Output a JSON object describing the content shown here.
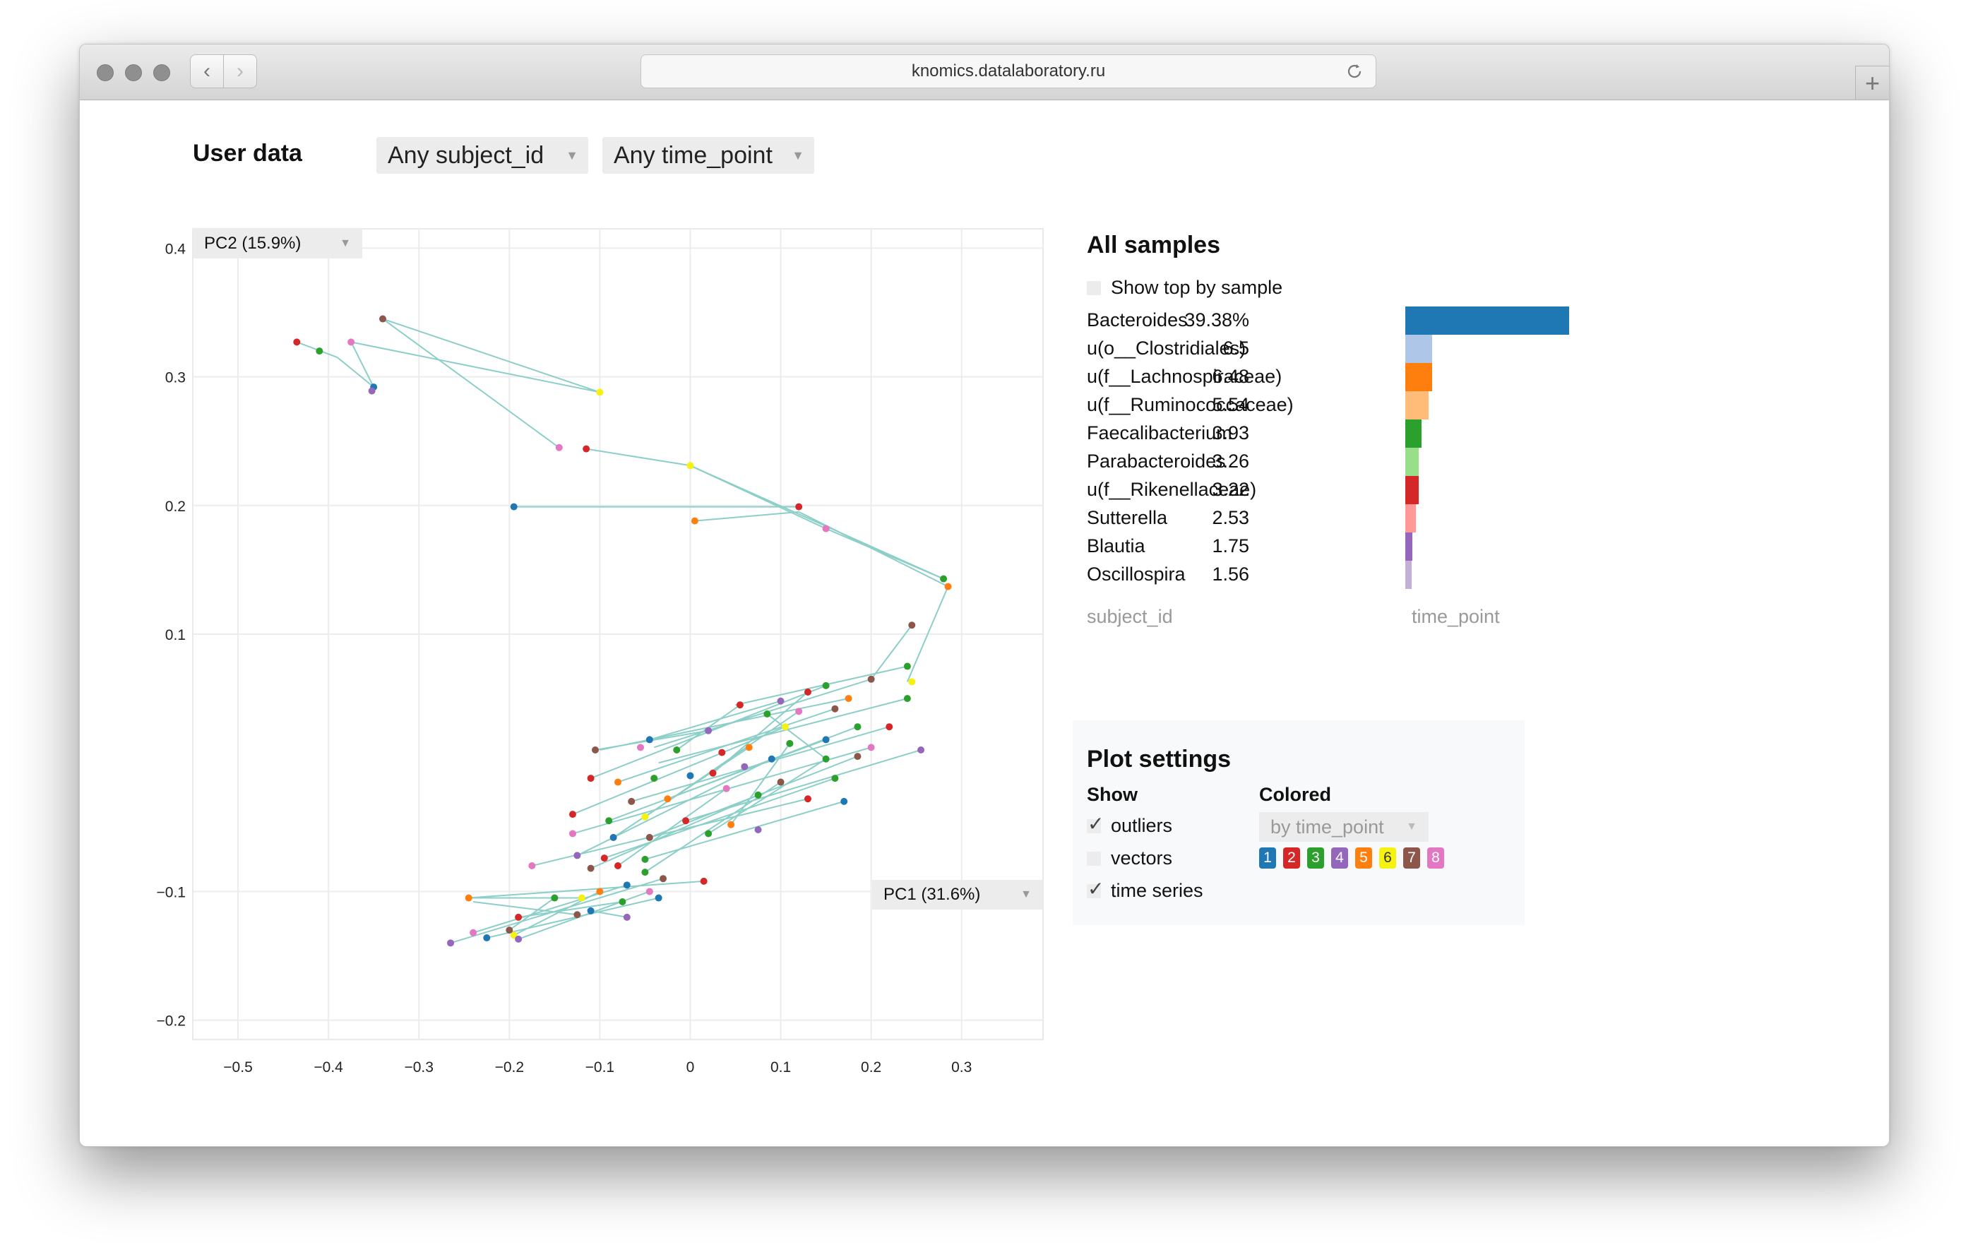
{
  "browser": {
    "url": "knomics.datalaboratory.ru"
  },
  "header": {
    "title": "User data",
    "subject_dropdown": "Any subject_id",
    "time_dropdown": "Any time_point"
  },
  "axes": {
    "y_select": "PC2 (15.9%)",
    "x_select": "PC1 (31.6%)"
  },
  "chart_data": {
    "type": "scatter",
    "xlim": [
      -0.55,
      0.39
    ],
    "ylim": [
      -0.215,
      0.415
    ],
    "x_ticks": [
      -0.5,
      -0.4,
      -0.3,
      -0.2,
      -0.1,
      0,
      0.1,
      0.2,
      0.3
    ],
    "x_tick_labels": [
      "−0.5",
      "−0.4",
      "−0.3",
      "−0.2",
      "−0.1",
      "0",
      "0.1",
      "0.2",
      "0.3"
    ],
    "y_ticks": [
      -0.2,
      -0.1,
      0.1,
      0.2,
      0.3,
      0.4
    ],
    "y_tick_labels": [
      "−0.2",
      "−0.1",
      "0.1",
      "0.2",
      "0.3",
      "0.4"
    ],
    "grid": true,
    "legend": "none",
    "point_colors": [
      "#1f77b4",
      "#d62728",
      "#2ca02c",
      "#9467bd",
      "#ff7f0e",
      "#f5f20f",
      "#8c564b",
      "#e377c2"
    ],
    "vector_color": "#8ccfc8",
    "points": [
      {
        "x": -0.435,
        "y": 0.327,
        "c": 2
      },
      {
        "x": -0.41,
        "y": 0.32,
        "c": 3
      },
      {
        "x": -0.375,
        "y": 0.327,
        "c": 8
      },
      {
        "x": -0.35,
        "y": 0.292,
        "c": 1
      },
      {
        "x": -0.352,
        "y": 0.289,
        "c": 4
      },
      {
        "x": -0.34,
        "y": 0.345,
        "c": 7
      },
      {
        "x": -0.1,
        "y": 0.288,
        "c": 6
      },
      {
        "x": -0.145,
        "y": 0.245,
        "c": 8
      },
      {
        "x": -0.115,
        "y": 0.244,
        "c": 2
      },
      {
        "x": -0.195,
        "y": 0.199,
        "c": 1
      },
      {
        "x": 0.0,
        "y": 0.231,
        "c": 6
      },
      {
        "x": 0.005,
        "y": 0.188,
        "c": 5
      },
      {
        "x": 0.12,
        "y": 0.199,
        "c": 2
      },
      {
        "x": 0.15,
        "y": 0.182,
        "c": 8
      },
      {
        "x": 0.28,
        "y": 0.143,
        "c": 3
      },
      {
        "x": 0.285,
        "y": 0.137,
        "c": 5
      },
      {
        "x": 0.245,
        "y": 0.107,
        "c": 7
      },
      {
        "x": 0.24,
        "y": 0.075,
        "c": 3
      },
      {
        "x": 0.245,
        "y": 0.063,
        "c": 6
      },
      {
        "x": 0.24,
        "y": 0.05,
        "c": 3
      },
      {
        "x": 0.2,
        "y": 0.065,
        "c": 7
      },
      {
        "x": 0.175,
        "y": 0.05,
        "c": 5
      },
      {
        "x": 0.15,
        "y": 0.06,
        "c": 3
      },
      {
        "x": 0.13,
        "y": 0.055,
        "c": 2
      },
      {
        "x": 0.1,
        "y": 0.048,
        "c": 4
      },
      {
        "x": 0.055,
        "y": 0.045,
        "c": 2
      },
      {
        "x": 0.085,
        "y": 0.038,
        "c": 3
      },
      {
        "x": 0.12,
        "y": 0.04,
        "c": 8
      },
      {
        "x": 0.16,
        "y": 0.042,
        "c": 7
      },
      {
        "x": 0.185,
        "y": 0.028,
        "c": 3
      },
      {
        "x": 0.105,
        "y": 0.028,
        "c": 6
      },
      {
        "x": 0.02,
        "y": 0.025,
        "c": 4
      },
      {
        "x": -0.045,
        "y": 0.018,
        "c": 1
      },
      {
        "x": 0.22,
        "y": 0.028,
        "c": 2
      },
      {
        "x": 0.15,
        "y": 0.018,
        "c": 1
      },
      {
        "x": 0.2,
        "y": 0.012,
        "c": 8
      },
      {
        "x": 0.255,
        "y": 0.01,
        "c": 4
      },
      {
        "x": 0.11,
        "y": 0.015,
        "c": 3
      },
      {
        "x": 0.065,
        "y": 0.012,
        "c": 5
      },
      {
        "x": 0.035,
        "y": 0.008,
        "c": 2
      },
      {
        "x": -0.015,
        "y": 0.01,
        "c": 3
      },
      {
        "x": -0.105,
        "y": 0.01,
        "c": 7
      },
      {
        "x": -0.055,
        "y": 0.012,
        "c": 8
      },
      {
        "x": 0.185,
        "y": 0.005,
        "c": 7
      },
      {
        "x": 0.15,
        "y": 0.003,
        "c": 3
      },
      {
        "x": 0.09,
        "y": 0.003,
        "c": 1
      },
      {
        "x": 0.06,
        "y": -0.003,
        "c": 4
      },
      {
        "x": 0.025,
        "y": -0.008,
        "c": 2
      },
      {
        "x": 0.0,
        "y": -0.01,
        "c": 1
      },
      {
        "x": -0.04,
        "y": -0.012,
        "c": 3
      },
      {
        "x": -0.08,
        "y": -0.015,
        "c": 5
      },
      {
        "x": -0.11,
        "y": -0.012,
        "c": 2
      },
      {
        "x": 0.1,
        "y": -0.015,
        "c": 7
      },
      {
        "x": 0.16,
        "y": -0.012,
        "c": 3
      },
      {
        "x": 0.04,
        "y": -0.02,
        "c": 8
      },
      {
        "x": 0.075,
        "y": -0.025,
        "c": 3
      },
      {
        "x": 0.13,
        "y": -0.028,
        "c": 2
      },
      {
        "x": 0.17,
        "y": -0.03,
        "c": 1
      },
      {
        "x": -0.025,
        "y": -0.028,
        "c": 5
      },
      {
        "x": -0.065,
        "y": -0.03,
        "c": 7
      },
      {
        "x": -0.13,
        "y": -0.04,
        "c": 2
      },
      {
        "x": -0.09,
        "y": -0.045,
        "c": 3
      },
      {
        "x": -0.05,
        "y": -0.042,
        "c": 6
      },
      {
        "x": -0.005,
        "y": -0.045,
        "c": 2
      },
      {
        "x": 0.045,
        "y": -0.048,
        "c": 5
      },
      {
        "x": 0.075,
        "y": -0.052,
        "c": 4
      },
      {
        "x": -0.13,
        "y": -0.055,
        "c": 8
      },
      {
        "x": -0.085,
        "y": -0.058,
        "c": 1
      },
      {
        "x": -0.045,
        "y": -0.058,
        "c": 7
      },
      {
        "x": 0.02,
        "y": -0.055,
        "c": 3
      },
      {
        "x": -0.125,
        "y": -0.072,
        "c": 4
      },
      {
        "x": -0.095,
        "y": -0.074,
        "c": 2
      },
      {
        "x": -0.05,
        "y": -0.075,
        "c": 3
      },
      {
        "x": -0.11,
        "y": -0.082,
        "c": 7
      },
      {
        "x": -0.08,
        "y": -0.08,
        "c": 2
      },
      {
        "x": -0.175,
        "y": -0.08,
        "c": 8
      },
      {
        "x": -0.05,
        "y": -0.085,
        "c": 3
      },
      {
        "x": -0.03,
        "y": -0.09,
        "c": 7
      },
      {
        "x": 0.015,
        "y": -0.092,
        "c": 2
      },
      {
        "x": -0.07,
        "y": -0.095,
        "c": 1
      },
      {
        "x": -0.1,
        "y": -0.1,
        "c": 5
      },
      {
        "x": -0.045,
        "y": -0.1,
        "c": 8
      },
      {
        "x": -0.12,
        "y": -0.105,
        "c": 6
      },
      {
        "x": -0.035,
        "y": -0.105,
        "c": 1
      },
      {
        "x": -0.075,
        "y": -0.108,
        "c": 3
      },
      {
        "x": -0.11,
        "y": -0.115,
        "c": 1
      },
      {
        "x": -0.15,
        "y": -0.105,
        "c": 3
      },
      {
        "x": -0.245,
        "y": -0.105,
        "c": 5
      },
      {
        "x": -0.125,
        "y": -0.118,
        "c": 7
      },
      {
        "x": -0.07,
        "y": -0.12,
        "c": 4
      },
      {
        "x": -0.19,
        "y": -0.12,
        "c": 2
      },
      {
        "x": -0.24,
        "y": -0.132,
        "c": 8
      },
      {
        "x": -0.265,
        "y": -0.14,
        "c": 4
      },
      {
        "x": -0.225,
        "y": -0.136,
        "c": 1
      },
      {
        "x": -0.195,
        "y": -0.134,
        "c": 6
      },
      {
        "x": -0.19,
        "y": -0.137,
        "c": 4
      },
      {
        "x": -0.2,
        "y": -0.13,
        "c": 7
      }
    ],
    "segments": [
      [
        -0.435,
        0.327,
        -0.39,
        0.315
      ],
      [
        -0.39,
        0.315,
        -0.35,
        0.292
      ],
      [
        -0.35,
        0.292,
        -0.375,
        0.327
      ],
      [
        -0.375,
        0.327,
        -0.1,
        0.288
      ],
      [
        -0.1,
        0.288,
        -0.34,
        0.345
      ],
      [
        -0.34,
        0.345,
        -0.145,
        0.245
      ],
      [
        -0.115,
        0.244,
        0.0,
        0.231
      ],
      [
        0.0,
        0.231,
        0.15,
        0.182
      ],
      [
        0.15,
        0.182,
        0.28,
        0.143
      ],
      [
        -0.195,
        0.199,
        0.12,
        0.199
      ],
      [
        0.005,
        0.188,
        0.12,
        0.195
      ],
      [
        0.12,
        0.195,
        0.285,
        0.137
      ],
      [
        0.285,
        0.137,
        0.24,
        0.063
      ],
      [
        0.28,
        0.143,
        0.0,
        0.231
      ],
      [
        0.245,
        0.107,
        0.2,
        0.065
      ],
      [
        0.24,
        0.075,
        0.05,
        0.045
      ],
      [
        0.24,
        0.05,
        -0.035,
        0.0
      ],
      [
        0.2,
        0.065,
        -0.04,
        0.012
      ],
      [
        0.175,
        0.05,
        -0.1,
        0.01
      ],
      [
        0.15,
        0.06,
        -0.11,
        -0.012
      ],
      [
        0.13,
        0.055,
        0.025,
        -0.008
      ],
      [
        0.1,
        0.048,
        -0.045,
        0.018
      ],
      [
        0.055,
        0.045,
        -0.015,
        0.01
      ],
      [
        0.085,
        0.038,
        0.15,
        0.003
      ],
      [
        0.12,
        0.04,
        -0.05,
        -0.042
      ],
      [
        0.16,
        0.042,
        -0.08,
        -0.015
      ],
      [
        0.185,
        0.028,
        -0.025,
        -0.028
      ],
      [
        0.105,
        0.028,
        -0.13,
        -0.04
      ],
      [
        0.02,
        0.025,
        -0.105,
        0.01
      ],
      [
        0.22,
        0.028,
        -0.065,
        -0.03
      ],
      [
        0.15,
        0.018,
        -0.09,
        -0.045
      ],
      [
        0.2,
        0.012,
        -0.13,
        -0.055
      ],
      [
        0.255,
        0.01,
        -0.005,
        -0.045
      ],
      [
        0.11,
        0.015,
        0.045,
        -0.048
      ],
      [
        0.065,
        0.012,
        -0.085,
        -0.058
      ],
      [
        0.185,
        0.005,
        -0.045,
        -0.058
      ],
      [
        0.15,
        0.003,
        0.02,
        -0.055
      ],
      [
        0.09,
        0.003,
        -0.125,
        -0.072
      ],
      [
        0.16,
        -0.012,
        -0.095,
        -0.074
      ],
      [
        0.17,
        -0.03,
        -0.05,
        -0.075
      ],
      [
        0.13,
        -0.028,
        -0.175,
        -0.08
      ],
      [
        0.075,
        -0.025,
        -0.11,
        -0.082
      ],
      [
        0.04,
        -0.02,
        -0.08,
        -0.08
      ],
      [
        0.1,
        -0.015,
        -0.05,
        -0.085
      ],
      [
        0.015,
        -0.092,
        -0.245,
        -0.105
      ],
      [
        -0.245,
        -0.105,
        -0.12,
        -0.105
      ],
      [
        -0.03,
        -0.09,
        -0.265,
        -0.14
      ],
      [
        -0.07,
        -0.095,
        -0.24,
        -0.132
      ],
      [
        -0.1,
        -0.1,
        -0.195,
        -0.134
      ],
      [
        -0.045,
        -0.1,
        -0.19,
        -0.137
      ],
      [
        -0.035,
        -0.105,
        -0.225,
        -0.136
      ],
      [
        -0.15,
        -0.105,
        -0.2,
        -0.13
      ],
      [
        -0.075,
        -0.108,
        -0.19,
        -0.12
      ],
      [
        -0.24,
        -0.108,
        -0.125,
        -0.118
      ],
      [
        -0.11,
        -0.115,
        -0.07,
        -0.12
      ]
    ]
  },
  "all_samples": {
    "title": "All samples",
    "show_top_label": "Show top by sample",
    "taxa": [
      {
        "name": "Bacteroides",
        "value": "39.38%",
        "num": 39.38,
        "color": "#1f77b4"
      },
      {
        "name": "u(o__Clostridiales)",
        "value": "6.5",
        "num": 6.5,
        "color": "#aec7e8"
      },
      {
        "name": "u(f__Lachnospiraceae)",
        "value": "6.48",
        "num": 6.48,
        "color": "#ff7f0e"
      },
      {
        "name": "u(f__Ruminococcaceae)",
        "value": "5.54",
        "num": 5.54,
        "color": "#ffbb78"
      },
      {
        "name": "Faecalibacterium",
        "value": "3.93",
        "num": 3.93,
        "color": "#2ca02c"
      },
      {
        "name": "Parabacteroides",
        "value": "3.26",
        "num": 3.26,
        "color": "#98df8a"
      },
      {
        "name": "u(f__Rikenellaceae)",
        "value": "3.22",
        "num": 3.22,
        "color": "#d62728"
      },
      {
        "name": "Sutterella",
        "value": "2.53",
        "num": 2.53,
        "color": "#ff9896"
      },
      {
        "name": "Blautia",
        "value": "1.75",
        "num": 1.75,
        "color": "#9467bd"
      },
      {
        "name": "Oscillospira",
        "value": "1.56",
        "num": 1.56,
        "color": "#c5b0d5"
      }
    ],
    "legend_subject": "subject_id",
    "legend_time": "time_point"
  },
  "plot_settings": {
    "title": "Plot settings",
    "show_head": "Show",
    "colored_head": "Colored",
    "outliers": "outliers",
    "vectors": "vectors",
    "time_series": "time series",
    "colored_by": "by time_point",
    "swatches": [
      {
        "label": "1",
        "color": "#1f77b4"
      },
      {
        "label": "2",
        "color": "#d62728"
      },
      {
        "label": "3",
        "color": "#2ca02c"
      },
      {
        "label": "4",
        "color": "#9467bd"
      },
      {
        "label": "5",
        "color": "#ff7f0e"
      },
      {
        "label": "6",
        "color": "#f5f20f"
      },
      {
        "label": "7",
        "color": "#8c564b"
      },
      {
        "label": "8",
        "color": "#e377c2"
      }
    ]
  }
}
